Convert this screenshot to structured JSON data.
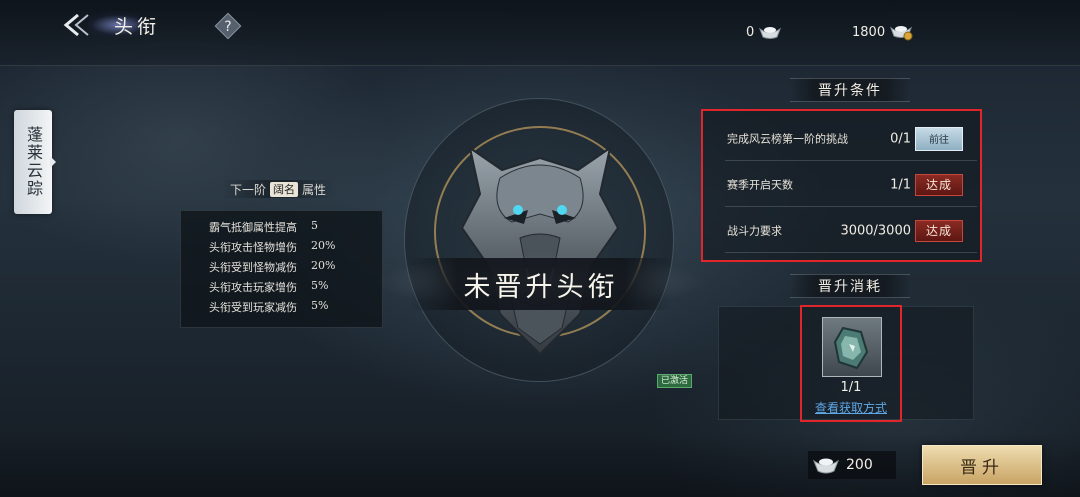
{
  "header": {
    "title": "头衔",
    "help_label": "?",
    "currency_silver": "0",
    "currency_gold": "1800"
  },
  "side_tab": {
    "label": "蓬莱云踪"
  },
  "attributes": {
    "header_prefix": "下一阶",
    "header_chip": "阔名",
    "header_suffix": "属性",
    "rows": [
      {
        "name": "霸气抵御属性提高",
        "value": "5"
      },
      {
        "name": "头衔攻击怪物增伤",
        "value": "20%"
      },
      {
        "name": "头衔受到怪物减伤",
        "value": "20%"
      },
      {
        "name": "头衔攻击玩家增伤",
        "value": "5%"
      },
      {
        "name": "头衔受到玩家减伤",
        "value": "5%"
      }
    ]
  },
  "emblem": {
    "rank_name": "未晋升头衔",
    "status_badge": "已激活"
  },
  "conditions": {
    "title": "晋升条件",
    "rows": [
      {
        "text": "完成风云榜第一阶的挑战",
        "count": "0/1",
        "action": "前往"
      },
      {
        "text": "赛季开启天数",
        "count": "1/1",
        "status": "达成"
      },
      {
        "text": "战斗力要求",
        "count": "3000/3000",
        "status": "达成"
      }
    ]
  },
  "cost": {
    "title": "晋升消耗",
    "item_count": "1/1",
    "item_link": "查看获取方式"
  },
  "footer": {
    "price": "200",
    "promote_label": "晋升"
  },
  "colors": {
    "highlight_red": "#e0262b",
    "gold_button": "#c9a464",
    "link_blue": "#5fa8e8",
    "done_badge": "#8a2a22"
  }
}
